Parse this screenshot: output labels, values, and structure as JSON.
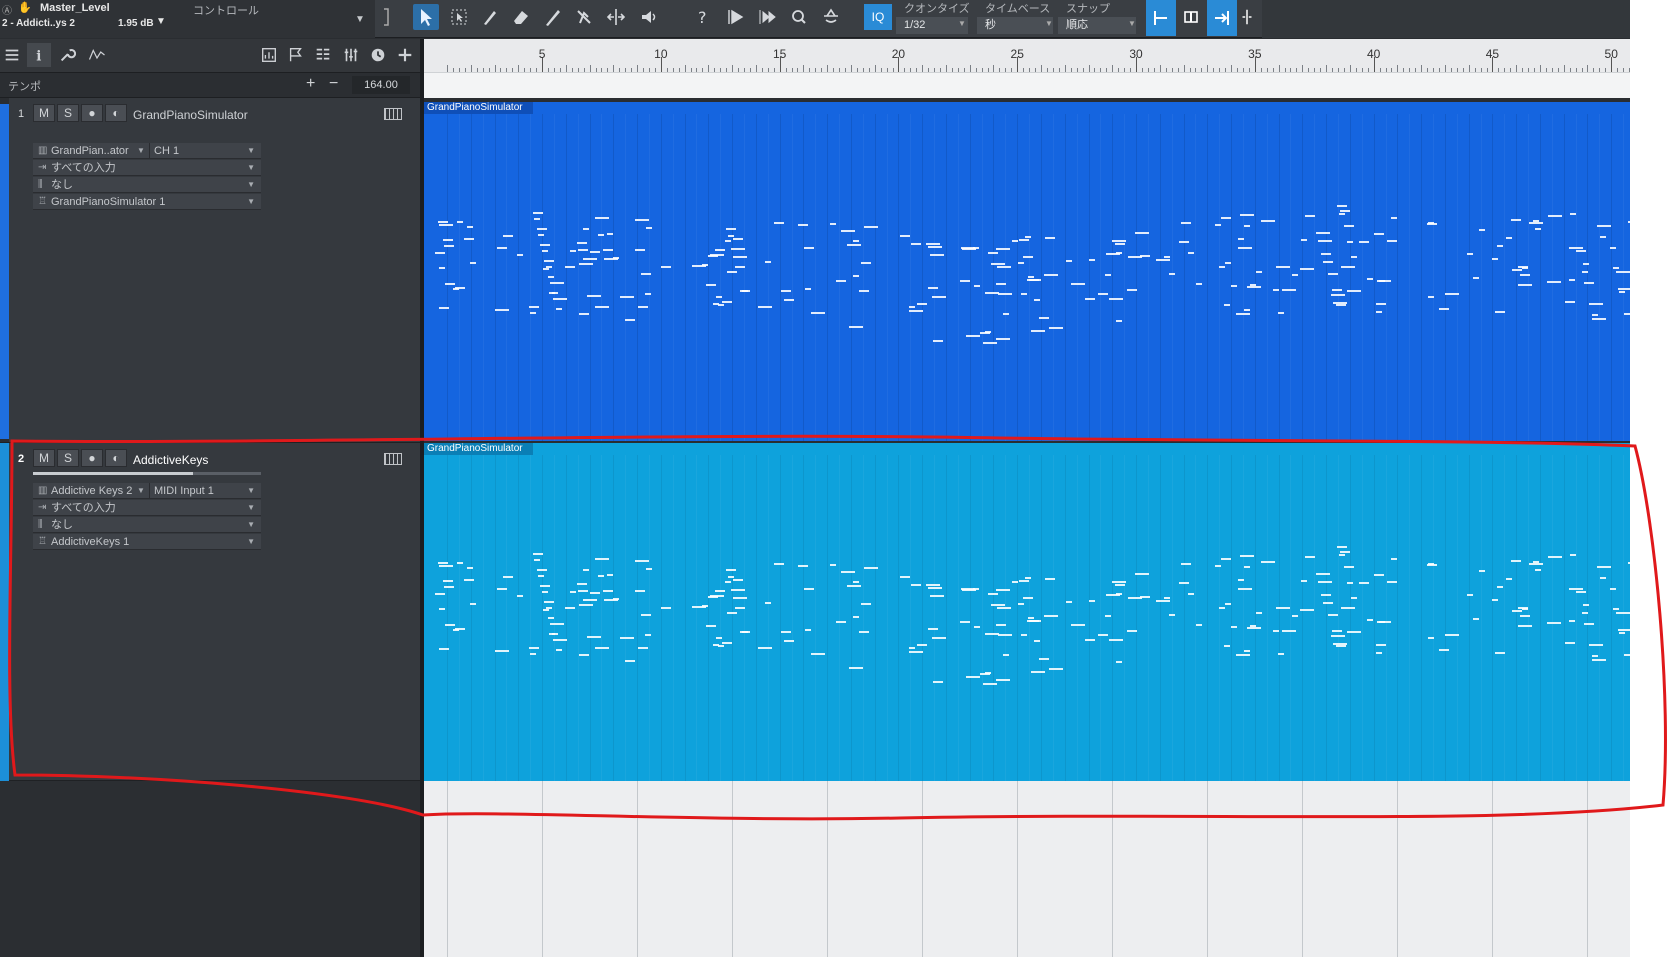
{
  "toolbar": {
    "project_title": "Master_Level",
    "project_sub": "2 - Addicti..ys 2",
    "level": "1.95 dB",
    "control_label": "コントロール",
    "iq_label": "IQ",
    "quantize_label": "クオンタイズ",
    "quantize_value": "1/32",
    "timebase_label": "タイムベース",
    "timebase_value": "秒",
    "snap_label": "スナップ",
    "snap_value": "順応"
  },
  "tempo": {
    "label": "テンポ",
    "value": "164.00"
  },
  "ruler": {
    "bars": [
      "5",
      "10",
      "15",
      "20",
      "25",
      "30",
      "35",
      "40",
      "45",
      "50"
    ]
  },
  "tracks": [
    {
      "number": "1",
      "mute": "M",
      "solo": "S",
      "name": "GrandPianoSimulator",
      "instrument": "GrandPian..ator",
      "channel": "CH 1",
      "input": "すべての入力",
      "output": "なし",
      "instrument_track": "GrandPianoSimulator 1",
      "clip_name": "GrandPianoSimulator",
      "color": "#1565e0"
    },
    {
      "number": "2",
      "mute": "M",
      "solo": "S",
      "name": "AddictiveKeys",
      "instrument": "Addictive Keys 2",
      "channel": "MIDI Input 1",
      "input": "すべての入力",
      "output": "なし",
      "instrument_track": "AddictiveKeys 1",
      "clip_name": "GrandPianoSimulator",
      "color": "#0ea2dc"
    }
  ],
  "colors": {
    "annotation": "#e0191b",
    "selected_tool": "#2c6fa8"
  }
}
